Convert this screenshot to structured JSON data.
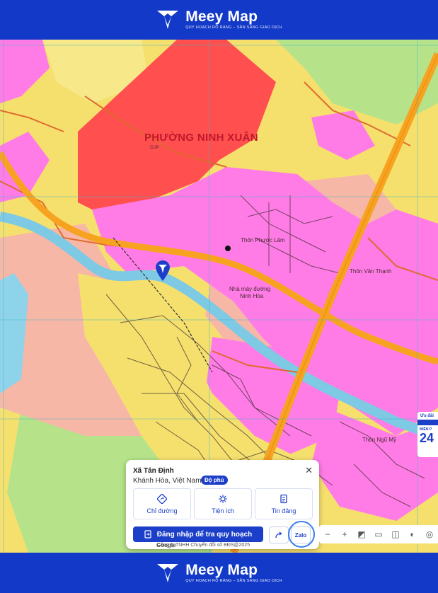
{
  "brand": {
    "name": "Meey Map",
    "slogan": "QUY HOẠCH RÕ RÀNG – SẴN SÀNG GIAO DỊCH"
  },
  "map": {
    "ward_label": "PHƯỜNG NINH XUÂN",
    "places": {
      "thon_phuoc_lam": "Thôn Phước Lâm",
      "thon_van_thanh": "Thôn Văn Thạnh",
      "nha_may_line1": "Nhà máy đường",
      "nha_may_line2": "Ninh Hòa",
      "thon_ngu_my": "Thôn Ngũ Mỹ",
      "code_cup": "CUP"
    },
    "colors": {
      "residential": "#ff7ce6",
      "agricultural": "#f5e06e",
      "forest": "#b6e38a",
      "industrial": "#f7b7a6",
      "commercial": "#ff4f4f",
      "water": "#8fd3ea",
      "highway": "#f7a321",
      "road": "#e06a2e"
    }
  },
  "panel": {
    "title": "Xã Tân Định",
    "region": "Khánh Hòa, Việt Nam",
    "badge": "Độ phủ",
    "actions": [
      {
        "label": "Chỉ đường",
        "icon": "directions-icon"
      },
      {
        "label": "Tiện ích",
        "icon": "amenities-icon"
      },
      {
        "label": "Tin đăng",
        "icon": "listing-icon"
      }
    ],
    "login_label": "Đăng nhập để tra quy hoạch",
    "zalo_label": "Zalo",
    "copyright": "Công ty TNHH Chuyển đổi số BĐS@2025",
    "google": "Google"
  },
  "toolbar": {
    "zoom_out": "−",
    "zoom_in": "+"
  },
  "promo": {
    "top": "Ưu đãi",
    "mid": "MIỀN P",
    "num": "24"
  }
}
